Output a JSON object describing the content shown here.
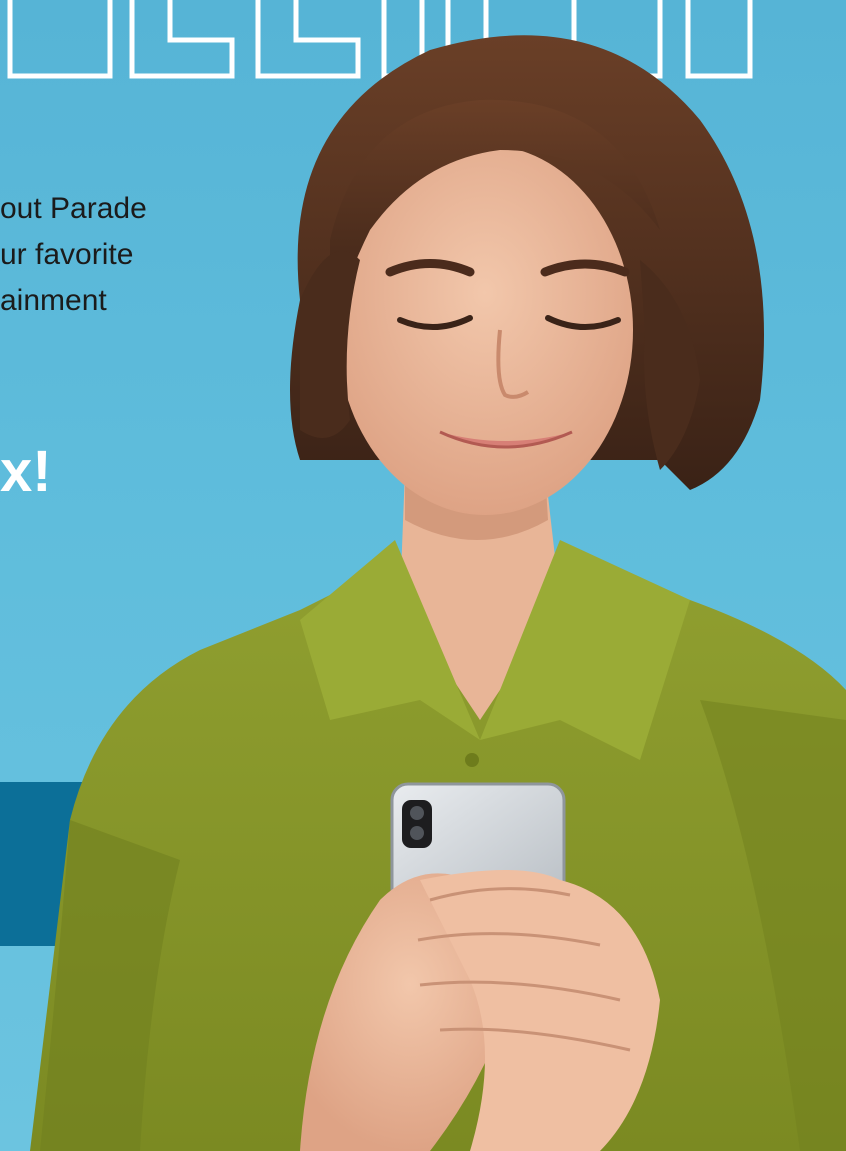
{
  "intro": {
    "lines": [
      "out Parade",
      "ur favorite",
      "ainment"
    ]
  },
  "headline": "x!",
  "colors": {
    "background": "#5cb8d8",
    "band": "#0c6f98",
    "shirt": "#8a9a2c",
    "headline": "#ffffff"
  }
}
